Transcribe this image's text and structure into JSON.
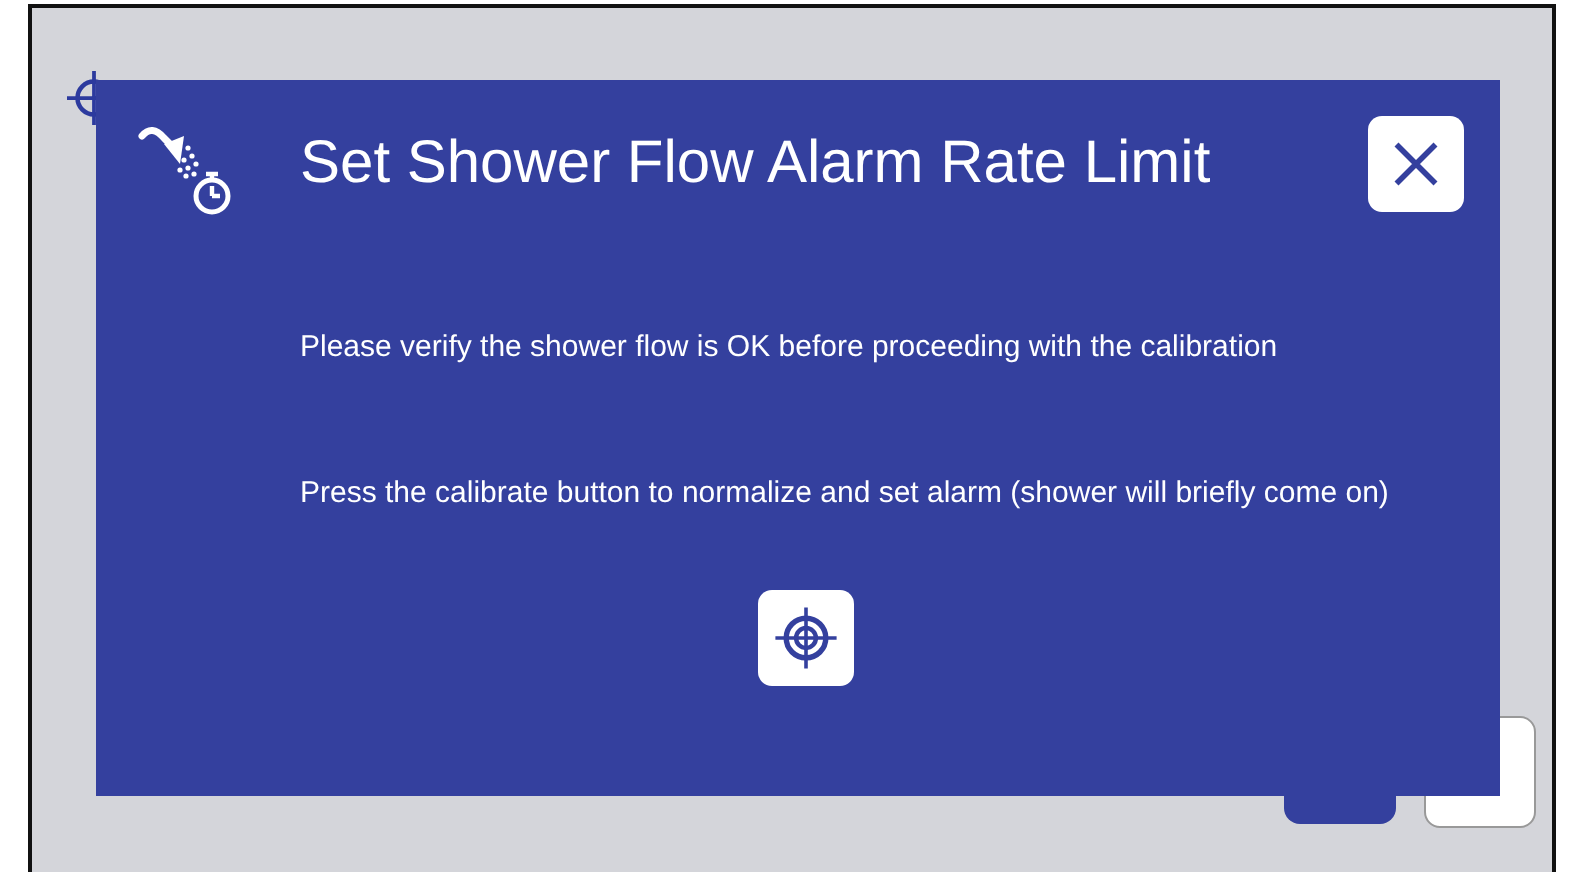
{
  "dialog": {
    "title": "Set Shower Flow Alarm Rate Limit",
    "messages": [
      "Please verify the shower flow is OK before proceeding with the calibration",
      "Press the calibrate button to normalize and set alarm (shower will briefly come on)"
    ]
  }
}
